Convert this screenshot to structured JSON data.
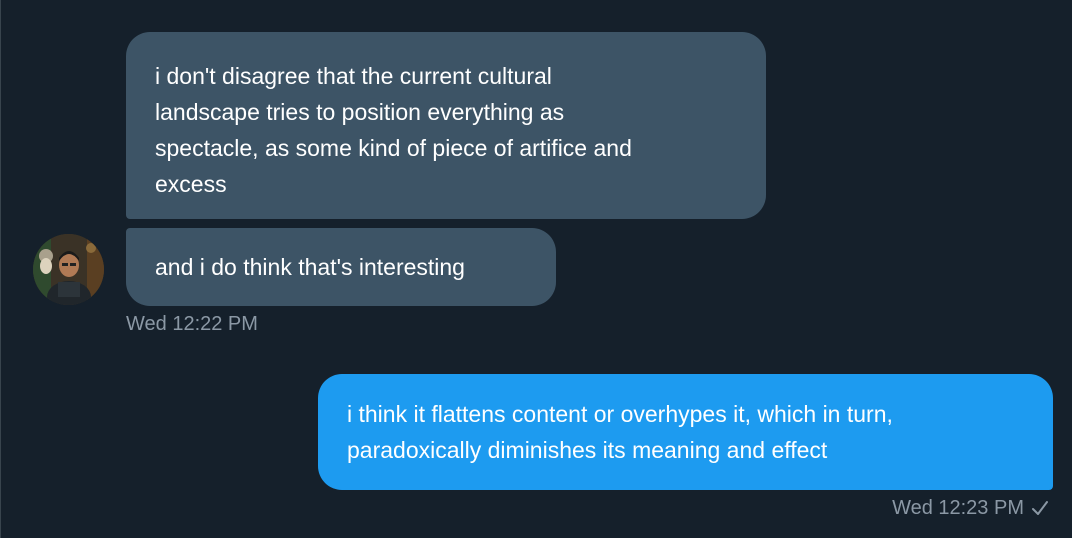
{
  "conversation": {
    "messages": [
      {
        "direction": "incoming",
        "lines": [
          "i don't disagree that the current cultural",
          "landscape tries to position everything as",
          "spectacle, as some kind of piece of artifice and",
          "excess"
        ]
      },
      {
        "direction": "incoming",
        "lines": [
          "and i do think that's interesting"
        ]
      },
      {
        "direction": "outgoing",
        "lines": [
          "i think it flattens content or overhypes it, which in turn,",
          "paradoxically diminishes its meaning and effect"
        ]
      }
    ],
    "incoming_timestamp": "Wed 12:22 PM",
    "outgoing_timestamp": "Wed 12:23 PM",
    "outgoing_status_icon": "check-icon"
  },
  "colors": {
    "background": "#15202b",
    "incoming_bubble": "#3d5466",
    "outgoing_bubble": "#1d9bf0",
    "timestamp_text": "#8b98a5",
    "message_text": "#ffffff"
  }
}
